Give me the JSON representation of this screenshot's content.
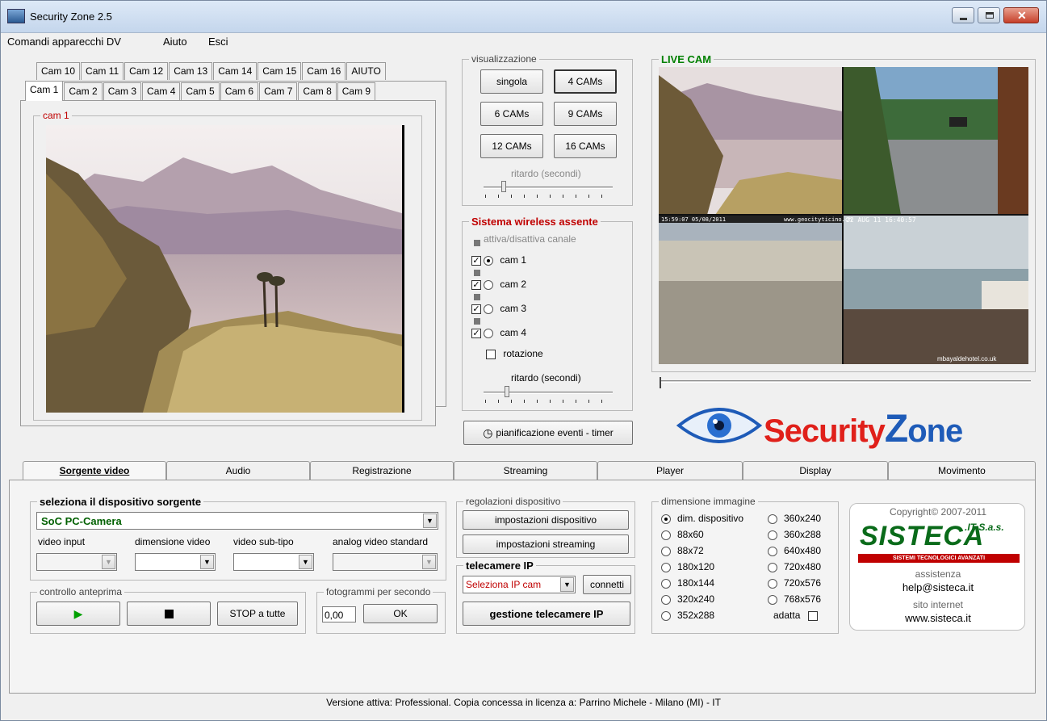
{
  "window": {
    "title": "Security Zone 2.5"
  },
  "menu": [
    "Comandi apparecchi DV",
    "Aiuto",
    "Esci"
  ],
  "cam_tabs_row1": [
    "Cam 10",
    "Cam 11",
    "Cam 12",
    "Cam 13",
    "Cam 14",
    "Cam 15",
    "Cam 16",
    "AIUTO"
  ],
  "cam_tabs_row2": [
    "Cam 1",
    "Cam 2",
    "Cam 3",
    "Cam 4",
    "Cam 5",
    "Cam 6",
    "Cam 7",
    "Cam 8",
    "Cam 9"
  ],
  "cam_group_label": "cam 1",
  "visualizzazione": {
    "label": "visualizzazione",
    "buttons": [
      "singola",
      "4 CAMs",
      "6 CAMs",
      "9 CAMs",
      "12 CAMs",
      "16 CAMs"
    ],
    "delay_label": "ritardo (secondi)"
  },
  "wireless": {
    "label": "Sistema wireless assente",
    "toggle_label": "attiva/disattiva canale",
    "cams": [
      "cam 1",
      "cam 2",
      "cam 3",
      "cam 4"
    ],
    "rotation_label": "rotazione",
    "delay_label": "ritardo (secondi)"
  },
  "scheduler_button": "pianificazione eventi - timer",
  "live_cam": {
    "label": "LIVE CAM",
    "overlay_tl": "15:59:07 05/08/2011",
    "overlay_tr": "www.geocityticino.ch",
    "overlay_tr2": "22 AUG 11 16:40:57",
    "overlay_bottom": "mbayaldehotel.co.uk"
  },
  "logo": {
    "part1": "Security",
    "part2": "Z",
    "part3": "one"
  },
  "bottom_tabs": [
    "Sorgente video",
    "Audio",
    "Registrazione",
    "Streaming",
    "Player",
    "Display",
    "Movimento"
  ],
  "source": {
    "label": "seleziona il dispositivo sorgente",
    "device": "SoC PC-Camera",
    "video_input": "video input",
    "video_size": "dimensione video",
    "video_subtype": "video sub-tipo",
    "analog_standard": "analog video standard"
  },
  "preview": {
    "label": "controllo anteprima",
    "stop_all": "STOP a tutte"
  },
  "fps": {
    "label": "fotogrammi per secondo",
    "value": "0,00",
    "ok": "OK"
  },
  "device_settings": {
    "label": "regolazioni dispositivo",
    "btn1": "impostazioni dispositivo",
    "btn2": "impostazioni streaming"
  },
  "ipcam": {
    "label": "telecamere IP",
    "select": "Seleziona IP cam",
    "connect": "connetti",
    "manage": "gestione telecamere IP"
  },
  "image_size": {
    "label": "dimensione immagine",
    "col1": [
      "dim. dispositivo",
      "88x60",
      "88x72",
      "180x120",
      "180x144",
      "320x240",
      "352x288"
    ],
    "col2": [
      "360x240",
      "360x288",
      "640x480",
      "720x480",
      "720x576",
      "768x576"
    ],
    "fit": "adatta",
    "selected": "dim. dispositivo"
  },
  "sisteca": {
    "copyright": "Copyright© 2007-2011",
    "name": "SISTECA",
    "suffix": ".IT S.a.s.",
    "tagline": "SISTEMI TECNOLOGICI AVANZATI",
    "assist_label": "assistenza",
    "email": "help@sisteca.it",
    "site_label": "sito internet",
    "site": "www.sisteca.it"
  },
  "status": "Versione attiva: Professional. Copia concessa in licenza a: Parrino Michele - Milano (MI) - IT",
  "colors": {
    "accent_red": "#c00000",
    "live_green": "#008000",
    "logo_blue": "#1e5bb8"
  }
}
